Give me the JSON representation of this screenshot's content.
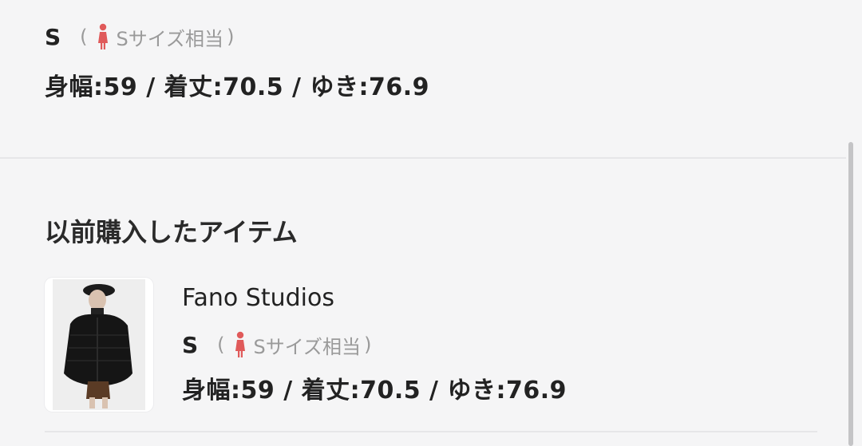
{
  "current_size": {
    "size": "S",
    "paren_open": "(",
    "note": "Sサイズ相当",
    "paren_close": ")",
    "measurements": "身幅:59 / 着丈:70.5 / ゆき:76.9"
  },
  "section_title": "以前購入したアイテム",
  "items": [
    {
      "brand": "Fano Studios",
      "size": "S",
      "paren_open": "(",
      "note": "Sサイズ相当",
      "paren_close": ")",
      "measurements": "身幅:59 / 着丈:70.5 / ゆき:76.9"
    }
  ],
  "colors": {
    "female_icon": "#e05a5a",
    "muted_text": "#9a9a9a"
  },
  "icons": {
    "size_note_icon": "female-figure-icon",
    "item_image": "product-thumbnail"
  }
}
